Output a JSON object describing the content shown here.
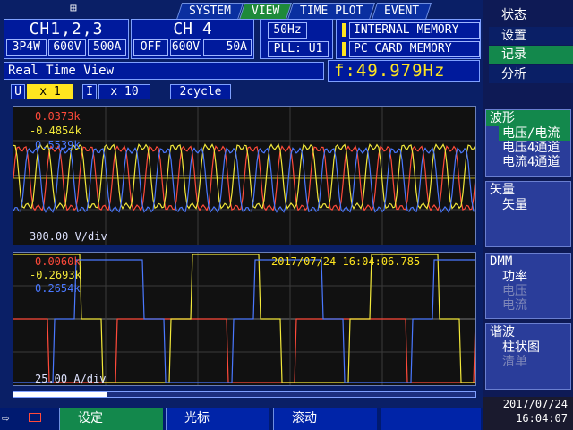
{
  "tabs": [
    "SYSTEM",
    "VIEW",
    "TIME PLOT",
    "EVENT"
  ],
  "active_tab": "VIEW",
  "ch123": {
    "title": "CH1,2,3",
    "wiring": "3P4W",
    "voltage": "600V",
    "current": "500A"
  },
  "ch4": {
    "title": "CH 4",
    "state": "OFF",
    "voltage": "600V",
    "current": "50A"
  },
  "freq_setting": "50Hz",
  "pll": "PLL: U1",
  "memory": {
    "internal": "INTERNAL MEMORY",
    "card": "PC CARD  MEMORY"
  },
  "view_title": "Real Time View",
  "frequency": {
    "label": "f:",
    "value": "49.979Hz"
  },
  "zoom": {
    "u_label": "U",
    "u_value": "x 1",
    "i_label": "I",
    "i_value": "x 10",
    "cycle": "2cycle"
  },
  "voltage_panel": {
    "readings": [
      "0.0373k",
      "-0.4854k",
      "0.5539k"
    ],
    "scale": "300.00 V/div"
  },
  "current_panel": {
    "readings": [
      "0.0060k",
      "-0.2693k",
      "0.2654k"
    ],
    "scale": "25.00 A/div",
    "timestamp": "2017/07/24  16:04:06.785"
  },
  "menu": {
    "status": "状态",
    "setup": "设置",
    "record": "记录",
    "analysis": "分析"
  },
  "waveform_section": {
    "title": "波形",
    "items": [
      "电压/电流",
      "电压4通道",
      "电流4通道"
    ]
  },
  "vector_section": {
    "title": "矢量",
    "items": [
      "矢量"
    ]
  },
  "dmm_section": {
    "title": "DMM",
    "items": [
      "功率",
      "电压",
      "电流"
    ]
  },
  "harmonic_section": {
    "title": "谐波",
    "items": [
      "柱状图",
      "清单"
    ]
  },
  "footer": {
    "setup": "设定",
    "cursor": "光标",
    "scroll": "滚动",
    "date": "2017/07/24",
    "time": "16:04:07"
  },
  "colors": {
    "phase1": "#ff4a3a",
    "phase2": "#f2e83a",
    "phase3": "#4a78ff",
    "accent": "#ffe51f",
    "active_tab": "#1e8a3a"
  }
}
